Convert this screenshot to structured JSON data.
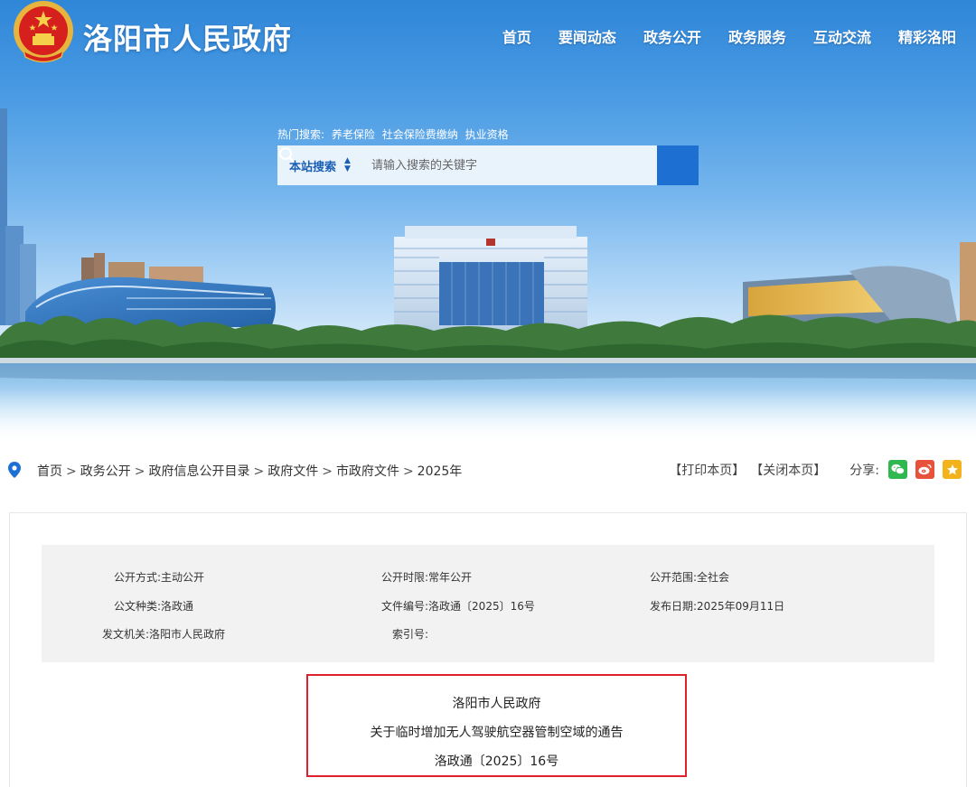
{
  "header": {
    "site_title": "洛阳市人民政府",
    "nav": [
      "首页",
      "要闻动态",
      "政务公开",
      "政务服务",
      "互动交流",
      "精彩洛阳"
    ]
  },
  "search": {
    "hot_label": "热门搜索:",
    "hot_items": [
      "养老保险",
      "社会保险费缴纳",
      "执业资格"
    ],
    "scope": "本站搜索",
    "placeholder": "请输入搜索的关键字"
  },
  "breadcrumb": {
    "items": [
      "首页",
      "政务公开",
      "政府信息公开目录",
      "政府文件",
      "市政府文件",
      "2025年"
    ],
    "separator": ">"
  },
  "tools": {
    "print": "【打印本页】",
    "close": "【关闭本页】",
    "share_label": "分享:"
  },
  "meta": {
    "rows": [
      [
        {
          "k": "公开方式:",
          "v": "主动公开"
        },
        {
          "k": "公开时限:",
          "v": "常年公开"
        },
        {
          "k": "公开范围:",
          "v": "全社会"
        }
      ],
      [
        {
          "k": "公文种类:",
          "v": "洛政通"
        },
        {
          "k": "文件编号:",
          "v": "洛政通〔2025〕16号"
        },
        {
          "k": "发布日期:",
          "v": "2025年09月11日"
        }
      ],
      [
        {
          "k": "发文机关:",
          "v": "洛阳市人民政府"
        },
        {
          "k": "索引号:",
          "v": ""
        }
      ]
    ]
  },
  "document": {
    "issuer": "洛阳市人民政府",
    "title": "关于临时增加无人驾驶航空器管制空域的通告",
    "number": "洛政通〔2025〕16号"
  },
  "colors": {
    "primary": "#1d6fd1",
    "highlight_border": "#e0212b",
    "meta_bg": "#f2f2f2",
    "wechat": "#2fb84f",
    "weibo": "#e8523b",
    "favorite": "#f2b21b"
  }
}
